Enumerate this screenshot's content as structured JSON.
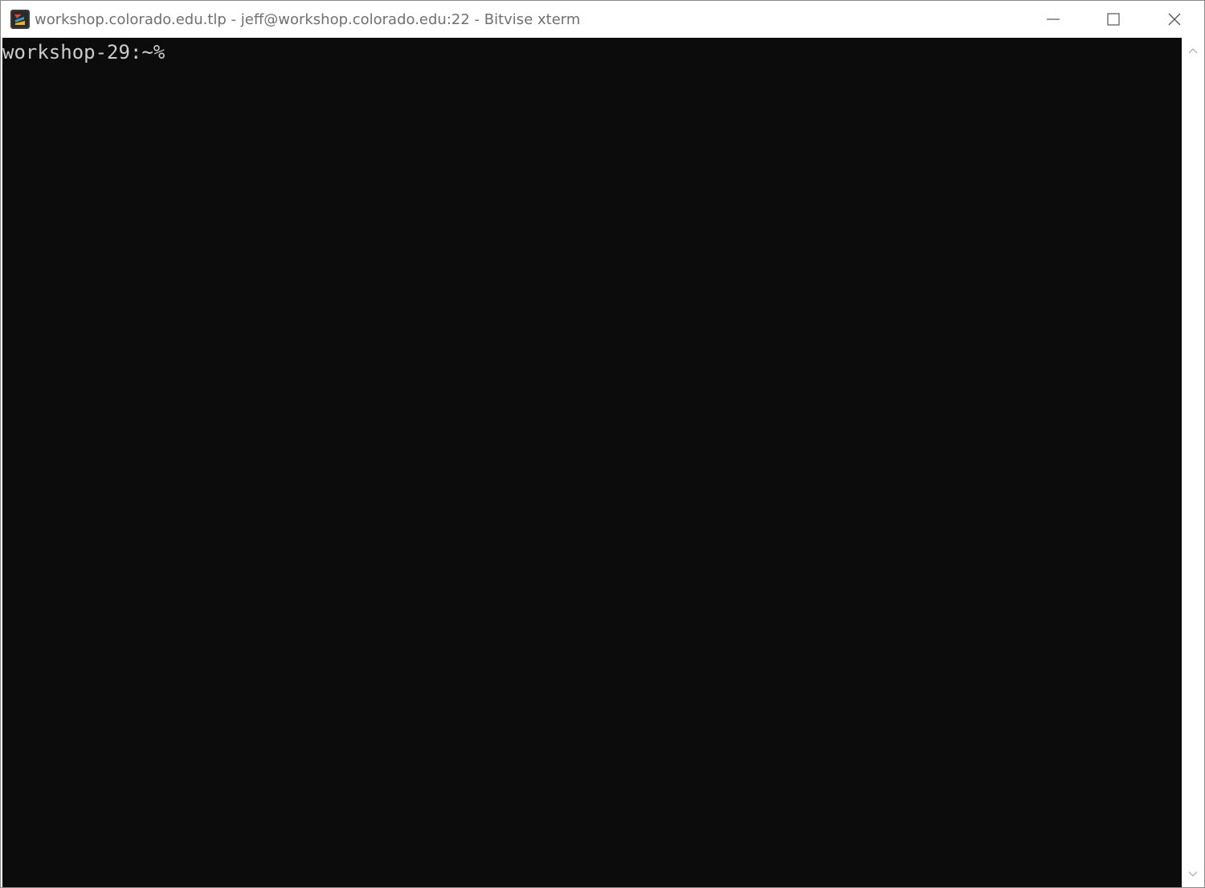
{
  "window": {
    "title": "workshop.colorado.edu.tlp - jeff@workshop.colorado.edu:22 - Bitvise xterm",
    "icon": "bitvise-app-icon",
    "controls": {
      "minimize_icon": "minimize-icon",
      "maximize_icon": "maximize-icon",
      "close_icon": "close-icon"
    }
  },
  "terminal": {
    "prompt": "workshop-29:~%",
    "background": "#0c0c0c",
    "foreground": "#cccccc"
  },
  "scrollbar": {
    "up_icon": "chevron-up-icon",
    "down_icon": "chevron-down-icon"
  }
}
